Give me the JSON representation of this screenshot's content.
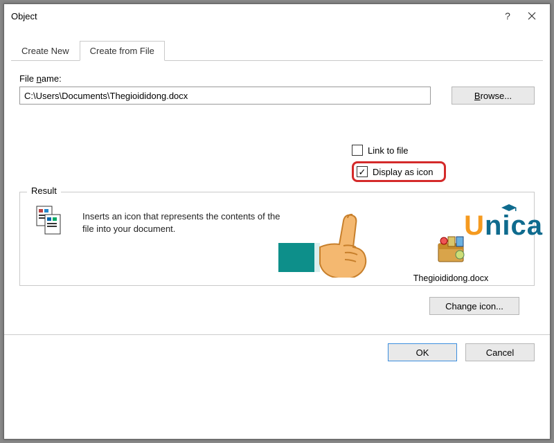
{
  "title": "Object",
  "tabs": {
    "create_new": "Create New",
    "create_from_file": "Create from File"
  },
  "file": {
    "label_pre": "File ",
    "label_u": "n",
    "label_post": "ame:",
    "value": "C:\\Users\\Documents\\Thegioididong.docx",
    "browse_u": "B",
    "browse_rest": "rowse..."
  },
  "checks": {
    "link_u": "L",
    "link_rest": "ink to file",
    "display_pre": "Displ",
    "display_u": "a",
    "display_post": "y as icon"
  },
  "result": {
    "legend": "Result",
    "text": "Inserts an icon that represents the contents of the file into your document."
  },
  "preview": {
    "filename": "Thegioididong.docx"
  },
  "change_icon": "Change icon...",
  "footer": {
    "ok": "OK",
    "cancel": "Cancel"
  },
  "watermark": {
    "u": "U",
    "rest": "nica"
  }
}
